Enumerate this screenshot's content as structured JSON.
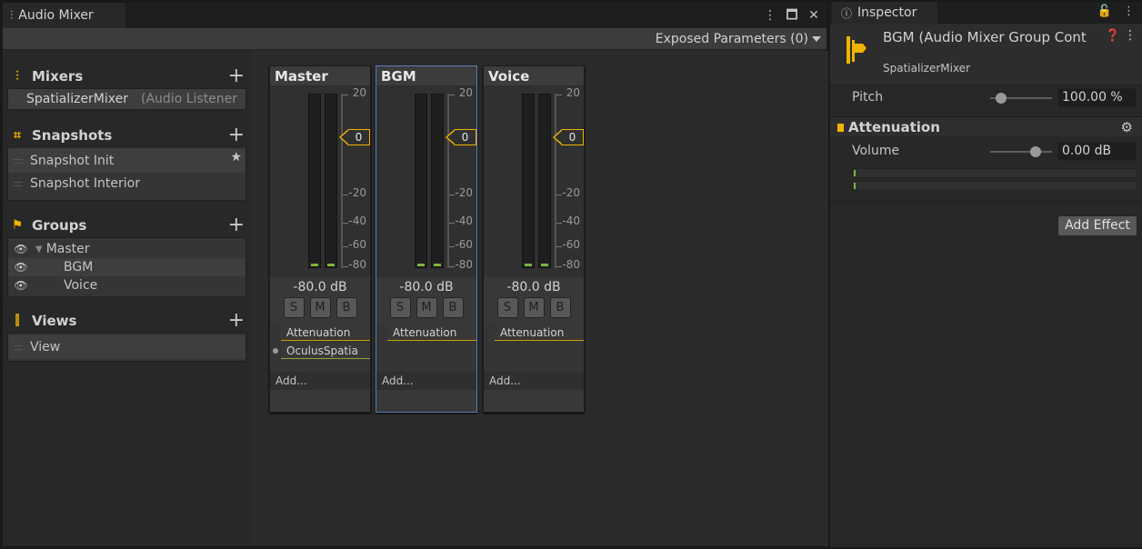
{
  "mixer_window": {
    "tab_title": "Audio Mixer",
    "exposed_parameters": "Exposed Parameters (0)"
  },
  "left_panel": {
    "mixers": {
      "title": "Mixers",
      "items": [
        {
          "name": "SpatializerMixer",
          "detail": "(Audio Listener"
        }
      ]
    },
    "snapshots": {
      "title": "Snapshots",
      "items": [
        {
          "name": "Snapshot Init"
        },
        {
          "name": "Snapshot Interior"
        }
      ]
    },
    "groups": {
      "title": "Groups",
      "items": [
        {
          "name": "Master"
        },
        {
          "name": "BGM"
        },
        {
          "name": "Voice"
        }
      ]
    },
    "views": {
      "title": "Views",
      "items": [
        {
          "name": "View"
        }
      ]
    }
  },
  "scale_ticks": [
    "20",
    "-20",
    "-40",
    "-60",
    "-80"
  ],
  "strips": [
    {
      "name": "Master",
      "fader_value": "0",
      "db": "-80.0 dB",
      "solo": "S",
      "mute": "M",
      "bypass": "B",
      "effects": [
        "Attenuation",
        "OculusSpatia"
      ],
      "add": "Add..."
    },
    {
      "name": "BGM",
      "fader_value": "0",
      "db": "-80.0 dB",
      "solo": "S",
      "mute": "M",
      "bypass": "B",
      "effects": [
        "Attenuation"
      ],
      "add": "Add..."
    },
    {
      "name": "Voice",
      "fader_value": "0",
      "db": "-80.0 dB",
      "solo": "S",
      "mute": "M",
      "bypass": "B",
      "effects": [
        "Attenuation"
      ],
      "add": "Add..."
    }
  ],
  "inspector": {
    "tab_title": "Inspector",
    "title": "BGM (Audio Mixer Group Cont",
    "subtitle": "SpatializerMixer",
    "pitch": {
      "label": "Pitch",
      "value": "100.00 %"
    },
    "component": {
      "title": "Attenuation"
    },
    "volume": {
      "label": "Volume",
      "value": "0.00 dB"
    },
    "add_effect": "Add Effect"
  },
  "colors": {
    "accent": "#f0b400",
    "selection": "#5b7fb8",
    "meter_green": "#7bb540"
  }
}
